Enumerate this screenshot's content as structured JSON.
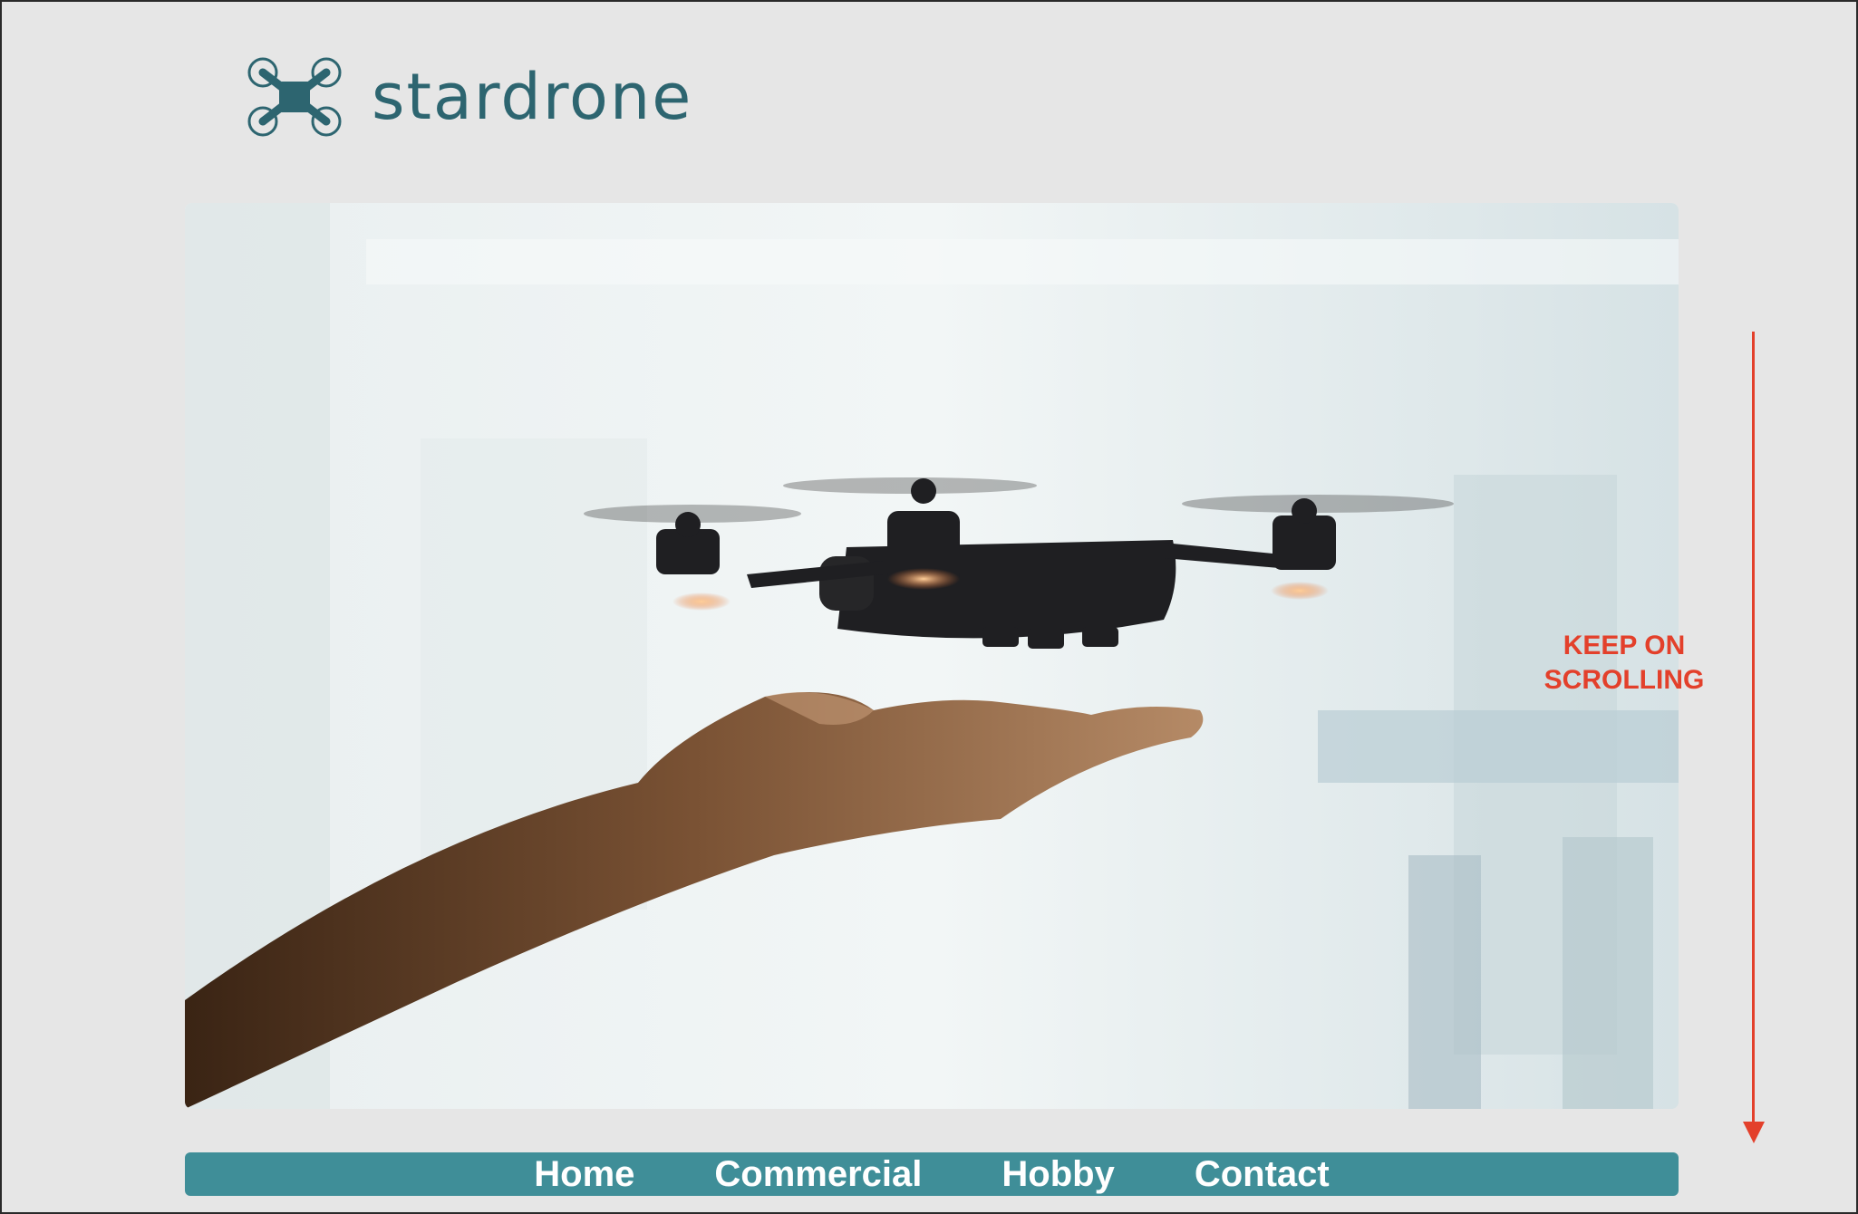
{
  "brand": {
    "name": "stardrone",
    "color": "#2d6570",
    "icon": "quadcopter-drone-icon"
  },
  "hero": {
    "image": "drone-hovering-over-hand-photo"
  },
  "nav": {
    "background": "#3f8e98",
    "items": [
      {
        "label": "Home"
      },
      {
        "label": "Commercial"
      },
      {
        "label": "Hobby"
      },
      {
        "label": "Contact"
      }
    ]
  },
  "annotation": {
    "text": "KEEP ON\nSCROLLING",
    "color": "#e3402b",
    "icon": "arrow-down-icon"
  }
}
